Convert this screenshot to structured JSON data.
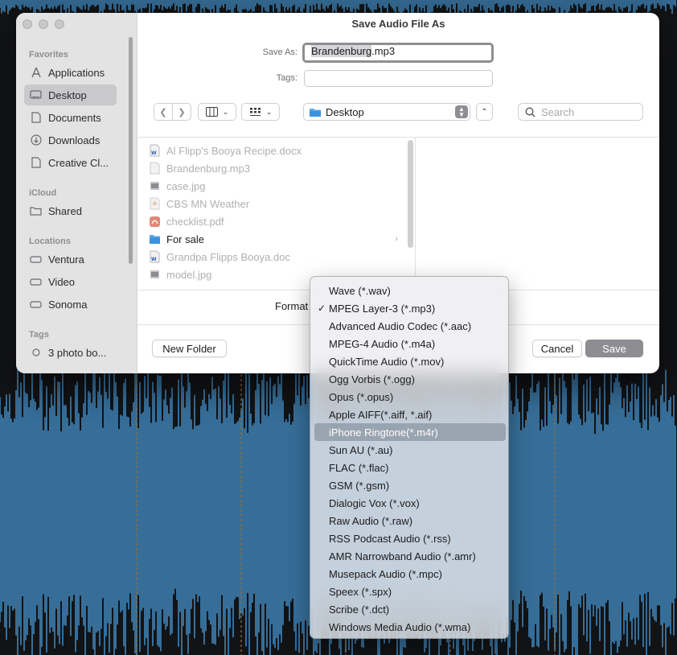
{
  "window": {
    "title": "Save Audio File As"
  },
  "sidebar": {
    "favorites_header": "Favorites",
    "favorites": [
      {
        "label": "Applications",
        "icon": "applications-icon"
      },
      {
        "label": "Desktop",
        "icon": "desktop-icon",
        "selected": true
      },
      {
        "label": "Documents",
        "icon": "document-icon"
      },
      {
        "label": "Downloads",
        "icon": "downloads-icon"
      },
      {
        "label": "Creative Cl...",
        "icon": "document-icon"
      }
    ],
    "icloud_header": "iCloud",
    "icloud": [
      {
        "label": "Shared",
        "icon": "shared-folder-icon"
      }
    ],
    "locations_header": "Locations",
    "locations": [
      {
        "label": "Ventura",
        "icon": "disk-icon"
      },
      {
        "label": "Video",
        "icon": "disk-icon"
      },
      {
        "label": "Sonoma",
        "icon": "disk-icon"
      }
    ],
    "tags_header": "Tags",
    "tags": [
      {
        "label": "3 photo bo...",
        "icon": "tag-circle-icon"
      }
    ]
  },
  "save_as": {
    "label": "Save As:",
    "value_selected": "Brandenburg",
    "value_ext": ".mp3"
  },
  "tags_field": {
    "label": "Tags:",
    "value": ""
  },
  "location": {
    "value": "Desktop"
  },
  "search": {
    "placeholder": "Search"
  },
  "files": [
    {
      "name": "Al Flipp's Booya Recipe.docx",
      "icon": "word-doc-icon",
      "enabled": false
    },
    {
      "name": "Brandenburg.mp3",
      "icon": "audio-file-icon",
      "enabled": false
    },
    {
      "name": "case.jpg",
      "icon": "image-file-icon",
      "enabled": false
    },
    {
      "name": "CBS MN Weather",
      "icon": "file-icon",
      "enabled": false
    },
    {
      "name": "checklist.pdf",
      "icon": "pdf-file-icon",
      "enabled": false
    },
    {
      "name": "For sale",
      "icon": "folder-icon",
      "enabled": true,
      "is_folder": true
    },
    {
      "name": "Grandpa Flipps Booya.doc",
      "icon": "word-doc-icon",
      "enabled": false
    },
    {
      "name": "model.jpg",
      "icon": "image-file-icon",
      "enabled": false
    }
  ],
  "format": {
    "label": "Format"
  },
  "buttons": {
    "new_folder": "New Folder",
    "cancel": "Cancel",
    "save": "Save"
  },
  "format_menu": {
    "checked_index": 1,
    "highlighted_index": 8,
    "items": [
      "Wave (*.wav)",
      "MPEG Layer-3 (*.mp3)",
      "Advanced Audio Codec (*.aac)",
      "MPEG-4 Audio (*.m4a)",
      "QuickTime Audio (*.mov)",
      "Ogg Vorbis (*.ogg)",
      "Opus (*.opus)",
      "Apple AIFF(*.aiff, *.aif)",
      "iPhone Ringtone(*.m4r)",
      "Sun AU (*.au)",
      "FLAC (*.flac)",
      "GSM (*.gsm)",
      "Dialogic Vox (*.vox)",
      "Raw Audio (*.raw)",
      "RSS Podcast Audio (*.rss)",
      "AMR Narrowband Audio (*.amr)",
      "Musepack Audio (*.mpc)",
      "Speex (*.spx)",
      "Scribe (*.dct)",
      "Windows Media Audio (*.wma)"
    ]
  },
  "colors": {
    "waveform": "#4a9fe0",
    "highlight": "#98a4b0",
    "save_button": "#8e8e92"
  }
}
